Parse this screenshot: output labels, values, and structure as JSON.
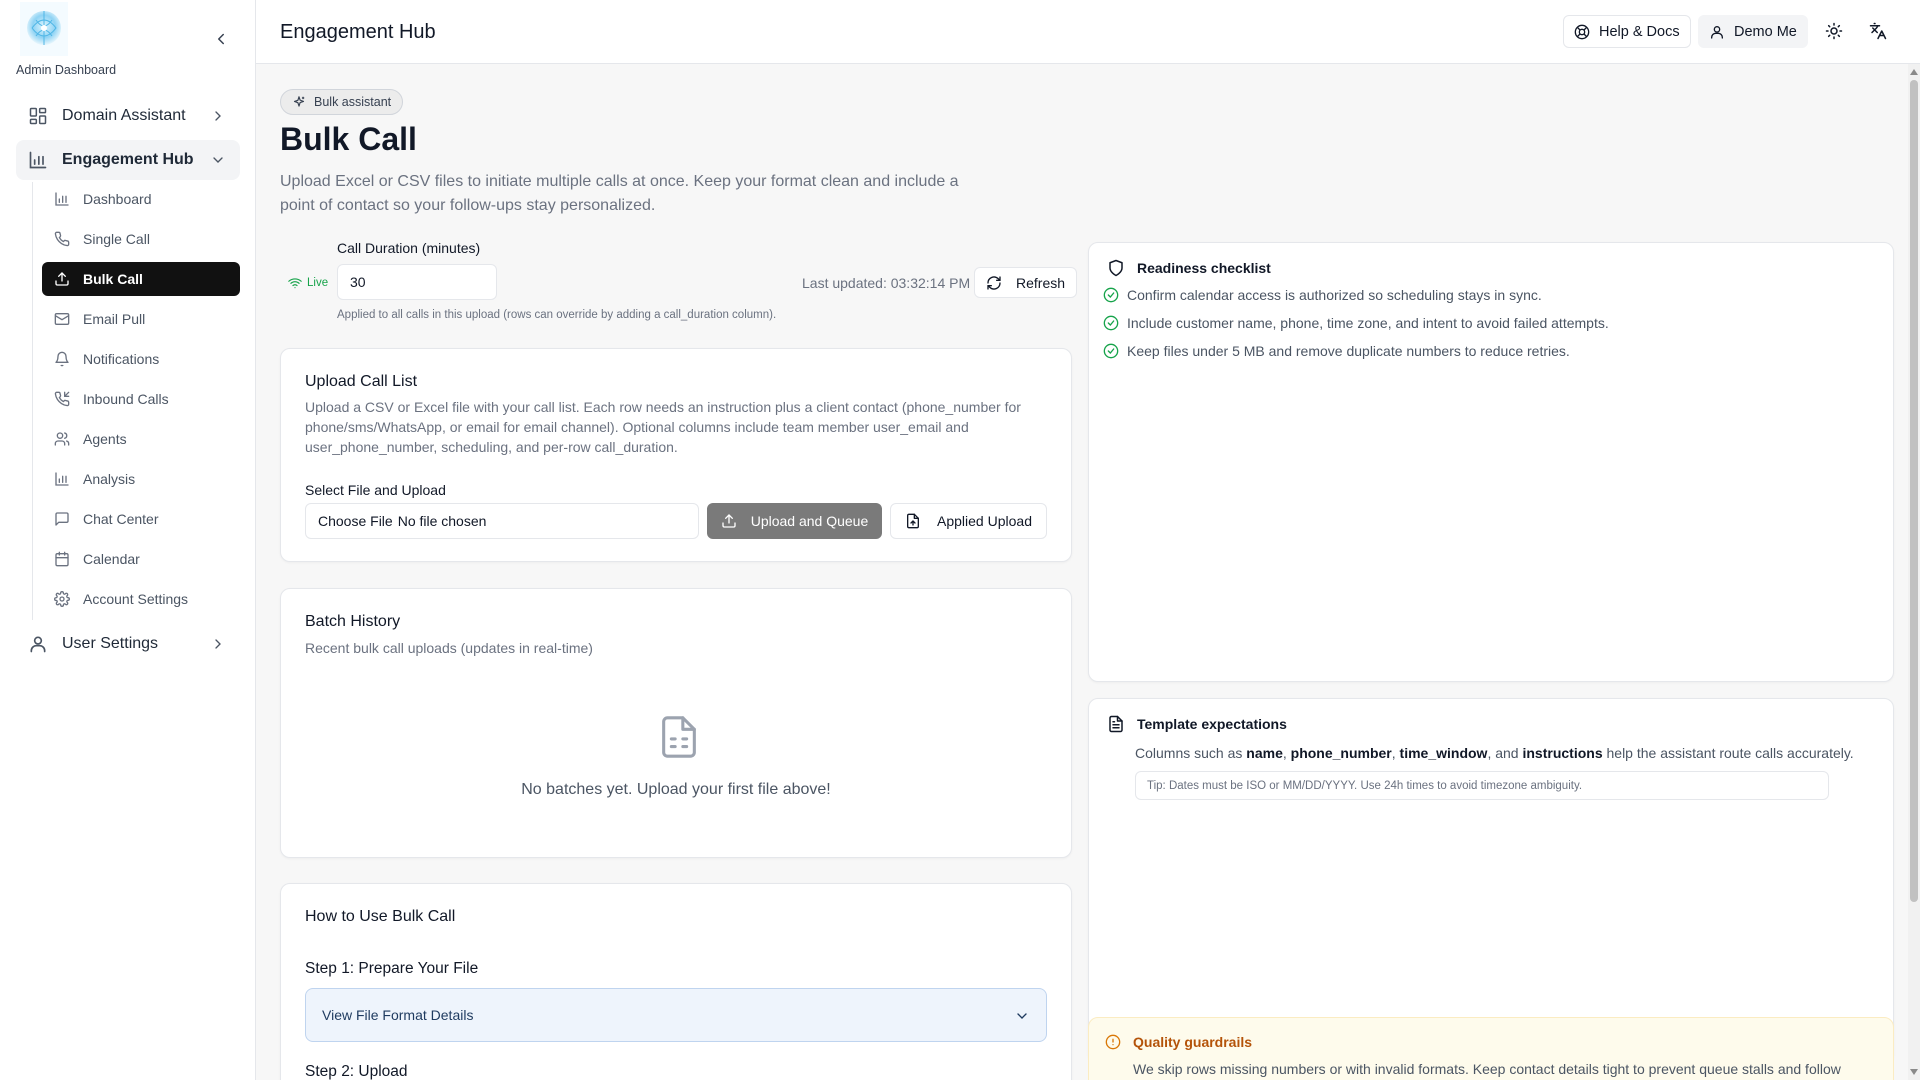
{
  "sidebar": {
    "brand": "Admin Dashboard",
    "domain_assistant": "Domain Assistant",
    "engagement_hub": "Engagement Hub",
    "user_settings": "User Settings",
    "items": [
      {
        "label": "Dashboard",
        "icon": "bar-chart-icon"
      },
      {
        "label": "Single Call",
        "icon": "phone-icon"
      },
      {
        "label": "Bulk Call",
        "icon": "upload-icon",
        "active": true
      },
      {
        "label": "Email Pull",
        "icon": "mail-icon"
      },
      {
        "label": "Notifications",
        "icon": "bell-icon"
      },
      {
        "label": "Inbound Calls",
        "icon": "phone-incoming-icon"
      },
      {
        "label": "Agents",
        "icon": "users-icon"
      },
      {
        "label": "Analysis",
        "icon": "bar-chart-icon"
      },
      {
        "label": "Chat Center",
        "icon": "message-square-icon"
      },
      {
        "label": "Calendar",
        "icon": "calendar-icon"
      },
      {
        "label": "Account Settings",
        "icon": "gear-icon"
      }
    ]
  },
  "header": {
    "title": "Engagement Hub",
    "help": "Help & Docs",
    "user": "Demo Me"
  },
  "main": {
    "badge": "Bulk assistant",
    "title": "Bulk Call",
    "description": "Upload Excel or CSV files to initiate multiple calls at once. Keep your format clean and include a point of contact so your follow-ups stay personalized.",
    "duration_label": "Call Duration (minutes)",
    "duration_value": "30",
    "live": "Live",
    "duration_note": "Applied to all calls in this upload (rows can override by adding a call_duration column).",
    "last_updated": "Last updated: 03:32:14 PM",
    "refresh": "Refresh"
  },
  "upload": {
    "title": "Upload Call List",
    "description": "Upload a CSV or Excel file with your call list. Each row needs an instruction plus a client contact (phone_number for phone/sms/WhatsApp, or email for email channel). Optional columns include team member user_email and user_phone_number, scheduling, and per-row call_duration.",
    "select_label": "Select File and Upload",
    "choose_file": "Choose File",
    "no_file": "No file chosen",
    "upload_queue": "Upload and Queue",
    "applied_upload": "Applied Upload"
  },
  "batch": {
    "title": "Batch History",
    "subtitle": "Recent bulk call uploads (updates in real-time)",
    "empty": "No batches yet. Upload your first file above!"
  },
  "howto": {
    "title": "How to Use Bulk Call",
    "step1": "Step 1: Prepare Your File",
    "accordion": "View File Format Details",
    "step2": "Step 2: Upload"
  },
  "readiness": {
    "title": "Readiness checklist",
    "items": [
      "Confirm calendar access is authorized so scheduling stays in sync.",
      "Include customer name, phone, time zone, and intent to avoid failed attempts.",
      "Keep files under 5 MB and remove duplicate numbers to reduce retries."
    ]
  },
  "template": {
    "title": "Template expectations",
    "prefix": "Columns such as",
    "cols": [
      "name",
      "phone_number",
      "time_window",
      "instructions"
    ],
    "sep1": ",",
    "sep2": ",",
    "and": ", and",
    "suffix": "help the assistant route calls accurately.",
    "tip": "Tip: Dates must be ISO or MM/DD/YYYY. Use 24h times to avoid timezone ambiguity."
  },
  "quality": {
    "title": "Quality guardrails",
    "text": "We skip rows missing numbers or with invalid formats. Keep contact details tight to prevent queue stalls and follow"
  },
  "colors": {
    "active_nav": "#111111",
    "primary_button_disabled": "#7a7a7a",
    "live_green": "#16a34a",
    "check_green": "#16a34a",
    "accordion_bg": "#eef4fc",
    "warning_bg": "#fefbec",
    "warning_text": "#b45309"
  }
}
